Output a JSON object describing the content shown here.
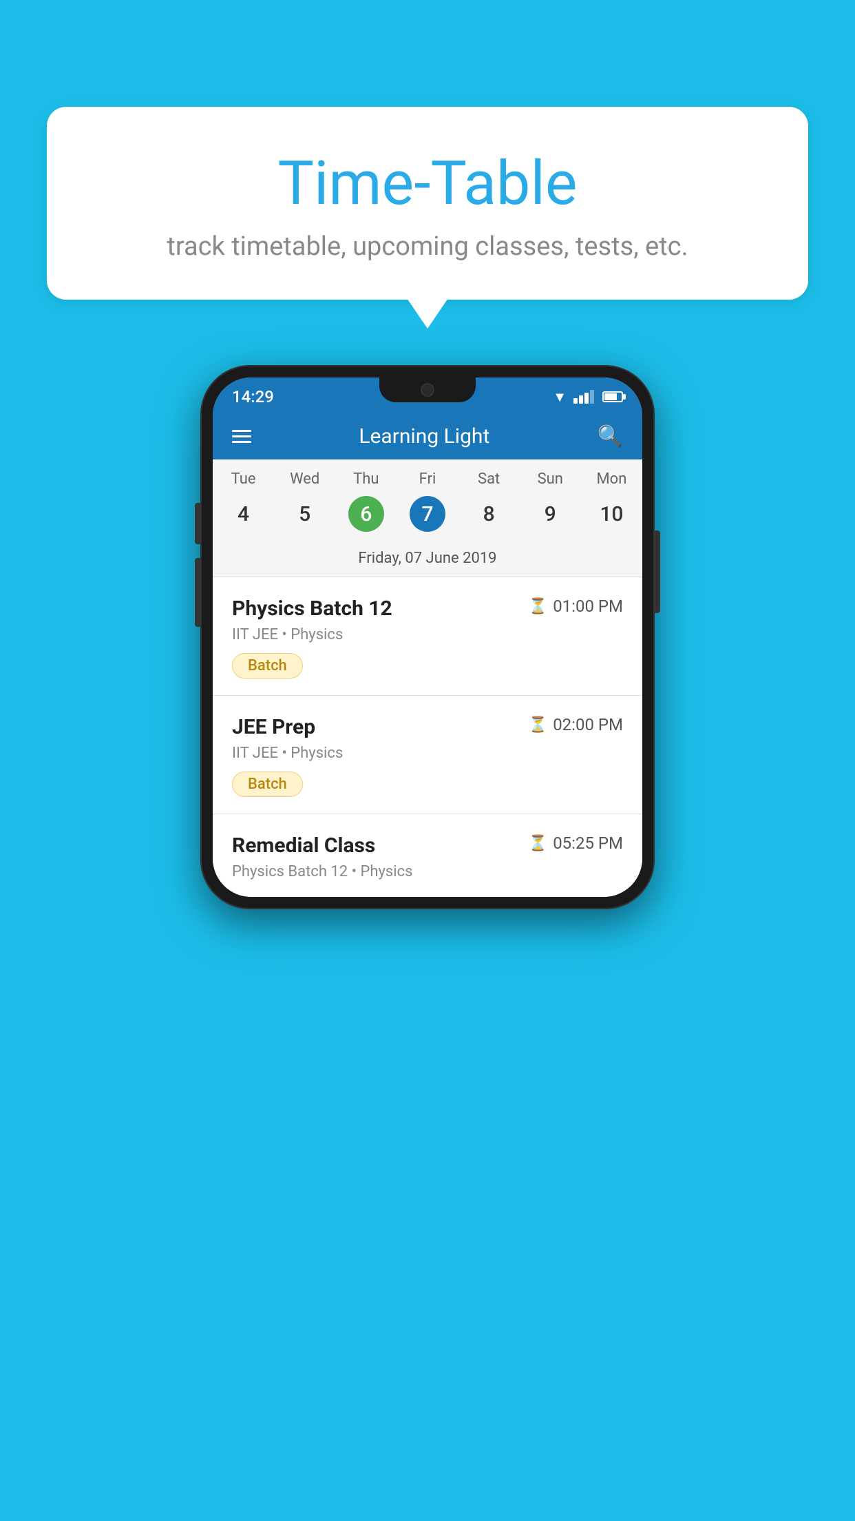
{
  "page": {
    "background_color": "#1BBDE8"
  },
  "speech_bubble": {
    "title": "Time-Table",
    "subtitle": "track timetable, upcoming classes, tests, etc."
  },
  "status_bar": {
    "time": "14:29"
  },
  "app_bar": {
    "title": "Learning Light"
  },
  "calendar": {
    "days": [
      "Tue",
      "Wed",
      "Thu",
      "Fri",
      "Sat",
      "Sun",
      "Mon"
    ],
    "dates": [
      "4",
      "5",
      "6",
      "7",
      "8",
      "9",
      "10"
    ],
    "today_index": 2,
    "selected_index": 3,
    "selected_label": "Friday, 07 June 2019"
  },
  "schedule_items": [
    {
      "name": "Physics Batch 12",
      "time": "01:00 PM",
      "sub": "IIT JEE • Physics",
      "tag": "Batch"
    },
    {
      "name": "JEE Prep",
      "time": "02:00 PM",
      "sub": "IIT JEE • Physics",
      "tag": "Batch"
    },
    {
      "name": "Remedial Class",
      "time": "05:25 PM",
      "sub": "Physics Batch 12 • Physics",
      "tag": ""
    }
  ]
}
